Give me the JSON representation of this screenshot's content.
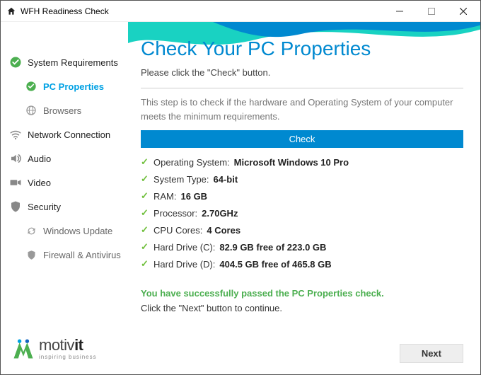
{
  "window": {
    "title": "WFH Readiness Check"
  },
  "sidebar": {
    "items": [
      {
        "label": "System Requirements"
      },
      {
        "label": "PC Properties"
      },
      {
        "label": "Browsers"
      },
      {
        "label": "Network Connection"
      },
      {
        "label": "Audio"
      },
      {
        "label": "Video"
      },
      {
        "label": "Security"
      },
      {
        "label": "Windows Update"
      },
      {
        "label": "Firewall & Antivirus"
      }
    ]
  },
  "logo": {
    "brand_light": "motiv",
    "brand_bold": "it",
    "tagline": "inspiring business"
  },
  "main": {
    "heading": "Check Your PC Properties",
    "subtitle": "Please click the \"Check\" button.",
    "description": "This step is to check if the hardware and Operating System of your computer meets the minimum requirements.",
    "check_label": "Check",
    "results": [
      {
        "label": "Operating System:",
        "value": "Microsoft Windows 10 Pro"
      },
      {
        "label": "System Type:",
        "value": "64-bit"
      },
      {
        "label": "RAM:",
        "value": "16 GB"
      },
      {
        "label": "Processor:",
        "value": "2.70GHz"
      },
      {
        "label": "CPU Cores:",
        "value": "4 Cores"
      },
      {
        "label": "Hard Drive (C):",
        "value": "82.9 GB free of 223.0 GB"
      },
      {
        "label": "Hard Drive (D):",
        "value": "404.5 GB free of 465.8 GB"
      }
    ],
    "success": "You have successfully passed the PC Properties check.",
    "next_hint": "Click the \"Next\" button to continue.",
    "next_label": "Next"
  }
}
